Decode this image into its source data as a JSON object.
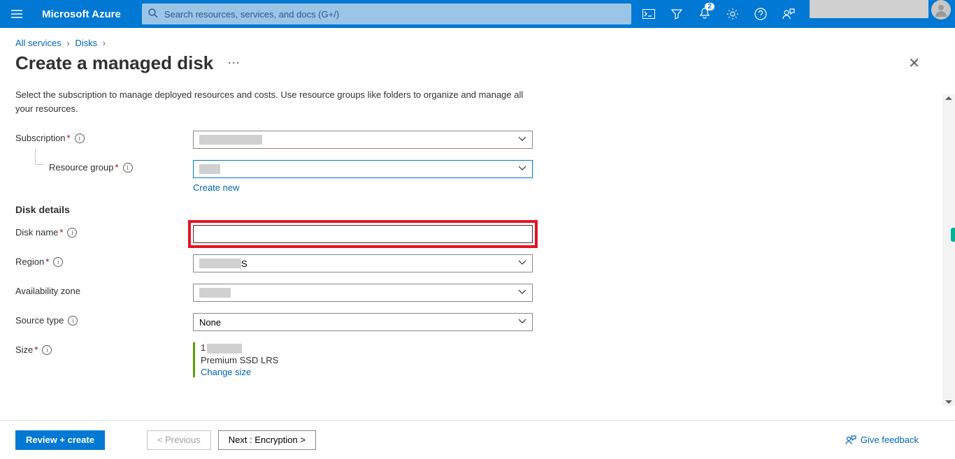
{
  "header": {
    "brand": "Microsoft Azure",
    "search_placeholder": "Search resources, services, and docs (G+/)",
    "notification_count": "2"
  },
  "breadcrumb": {
    "items": [
      "All services",
      "Disks"
    ]
  },
  "page": {
    "title": "Create a managed disk",
    "intro": "Select the subscription to manage deployed resources and costs. Use resource groups like folders to organize and manage all your resources."
  },
  "fields": {
    "subscription": {
      "label": "Subscription"
    },
    "resource_group": {
      "label": "Resource group",
      "create_new": "Create new"
    },
    "section_disk": "Disk details",
    "disk_name": {
      "label": "Disk name"
    },
    "region": {
      "label": "Region",
      "value_suffix": "S"
    },
    "availability_zone": {
      "label": "Availability zone"
    },
    "source_type": {
      "label": "Source type",
      "value": "None"
    },
    "size": {
      "label": "Size",
      "line1_prefix": "1",
      "line2": "Premium SSD LRS",
      "change": "Change size"
    }
  },
  "footer": {
    "review": "Review + create",
    "previous": "< Previous",
    "next": "Next : Encryption >",
    "feedback": "Give feedback"
  }
}
